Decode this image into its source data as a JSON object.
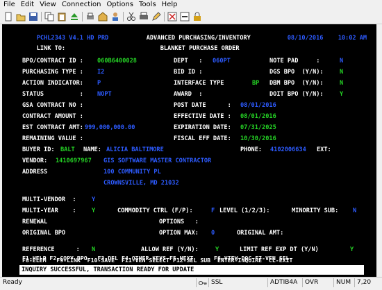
{
  "menu": {
    "file": "File",
    "edit": "Edit",
    "view": "View",
    "connection": "Connection",
    "options": "Options",
    "tools": "Tools",
    "help": "Help"
  },
  "icons": [
    "new-icon",
    "open-icon",
    "save-icon",
    "copy-icon",
    "paste-icon",
    "eject-icon",
    "print-icon",
    "home-icon",
    "person-icon",
    "scissors-icon",
    "print2-icon",
    "pencil-icon",
    "x-icon",
    "delete-icon",
    "lock-icon"
  ],
  "screen": {
    "header_left": "PCHL2343 V4.1 HD PRD",
    "header_title": "ADVANCED PURCHASING/INVENTORY",
    "header_date": "08/10/2016",
    "header_time": "10:02 AM",
    "link_to_label": "LINK TO:",
    "subtitle": "BLANKET PURCHASE ORDER",
    "bpo_label": "BPO/CONTRACT ID :",
    "bpo_value": "060B6400028",
    "dept_label": "DEPT   :",
    "dept_value": "060PT",
    "notepad_label": "NOTE PAD     :",
    "notepad_value": "N",
    "ptype_label": "PURCHASING TYPE :",
    "ptype_value": "I2",
    "bid_label": "BID ID :",
    "dgs_label": "DGS BPO  (Y/N):",
    "dgs_value": "N",
    "action_label": "ACTION INDICATOR:",
    "action_value": "P",
    "iface_label": "INTERFACE TYPE",
    "iface_value": "BP",
    "dbm_label": "DBM BPO  (Y/N):",
    "dbm_value": "N",
    "status_label": "STATUS          :",
    "status_value": "NOPT",
    "award_label": "AWARD  :",
    "doit_label": "DOIT BPO (Y/N):",
    "doit_value": "Y",
    "gsa_label": "GSA CONTRACT NO :",
    "post_label": "POST DATE      :",
    "post_value": "08/01/2016",
    "camt_label": "CONTRACT AMOUNT :",
    "eff_label": "EFFECTIVE DATE :",
    "eff_value": "08/01/2016",
    "est_label": "EST CONTRACT AMT:",
    "est_value": "999,000,000.00",
    "exp_label": "EXPIRATION DATE:",
    "exp_value": "07/31/2025",
    "rem_label": "REMAINING VALUE :",
    "fiscal_label": "FISCAL EFF DATE:",
    "fiscal_value": "10/30/2016",
    "buyer_label": "BUYER ID:",
    "buyer_id": "BALT",
    "name_label": "NAME:",
    "buyer_name": "ALICIA BALTIMORE",
    "phone_label": "PHONE:",
    "phone_value": "4102006634",
    "ext_label": "EXT:",
    "vendor_label": "VENDOR:",
    "vendor_id": "1410697967",
    "vendor_name": "GIS SOFTWARE MASTER CONTRACTOR",
    "address_label": "ADDRESS",
    "addr1": "100 COMMUNITY PL",
    "addr2": "CROWNSVILLE, MD 21032",
    "multiv_label": "MULTI-VENDOR  :",
    "multiv_value": "Y",
    "multiy_label": "MULTI-YEAR    :",
    "multiy_value": "Y",
    "commodity_label": "COMMODITY CTRL (F/P):",
    "commodity_value": "F",
    "level_label": "LEVEL (1/2/3):",
    "minority_label": "MINORITY SUB:",
    "minority_value": "N",
    "renewal_label": "RENEWAL",
    "options_label": "OPTIONS   :",
    "origbpo_label": "ORIGINAL BPO",
    "optmax_label": "OPTION MAX:",
    "optmax_value": "0",
    "origamt_label": "ORIGINAL AMT:",
    "ref_label": "REFERENCE      :",
    "ref_value": "N",
    "allowref_label": "ALLOW REF (Y/N):",
    "allowref_value": "Y",
    "limitref_label": "LIMIT REF EXP DT (Y/N)",
    "limitref_value": "Y",
    "fkeys1": "F1-HELP F2-COPY BPO   F3-DEL F4-OTHER KEYS F5-NEXT      F6-VIEW DOC F7-VEN SEL",
    "fkeys2": "F8-ELEM   F9-LINK  F10-SAVE  F11-VEN SELECT F12-SEL SUB  ENTER-INQUIRE  CL-EXIT",
    "message": "INQUIRY SUCCESSFUL, TRANSACTION READY FOR UPDATE"
  },
  "statusbar": {
    "ready": "Ready",
    "ssl": "SSL",
    "session": "ADTIB4A",
    "ovr": "OVR",
    "num": "NUM",
    "cursor": "7,20"
  }
}
